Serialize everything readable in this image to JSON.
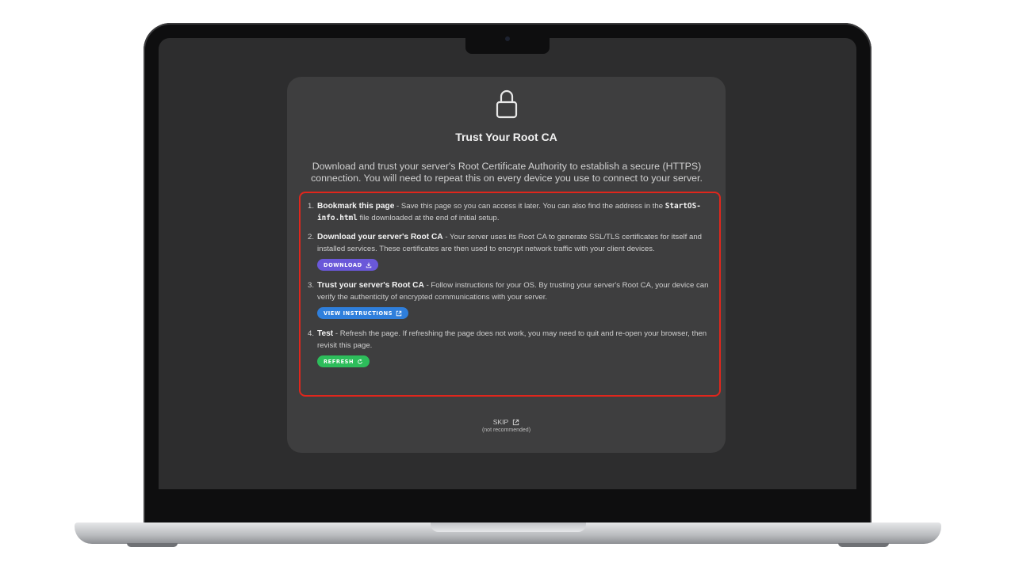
{
  "card": {
    "title": "Trust Your Root CA",
    "description": "Download and trust your server's Root Certificate Authority to establish a secure (HTTPS) connection. You will need to repeat this on every device you use to connect to your server."
  },
  "steps": [
    {
      "number": "1.",
      "title": "Bookmark this page",
      "text_before": " - Save this page so you can access it later. You can also find the address in the ",
      "code": "StartOS-info.html",
      "text_after": " file downloaded at the end of initial setup."
    },
    {
      "number": "2.",
      "title": "Download your server's Root CA",
      "text": " - Your server uses its Root CA to generate SSL/TLS certificates for itself and installed services. These certificates are then used to encrypt network traffic with your client devices.",
      "button": "DOWNLOAD",
      "button_icon": "download-icon"
    },
    {
      "number": "3.",
      "title": "Trust your server's Root CA",
      "text": " - Follow instructions for your OS. By trusting your server's Root CA, your device can verify the authenticity of encrypted communications with your server.",
      "button": "VIEW INSTRUCTIONS",
      "button_icon": "external-link-icon"
    },
    {
      "number": "4.",
      "title": "Test",
      "text": " - Refresh the page. If refreshing the page does not work, you may need to quit and re-open your browser, then revisit this page.",
      "button": "REFRESH",
      "button_icon": "refresh-icon"
    }
  ],
  "skip": {
    "label": "SKIP",
    "note": "(not recommended)"
  },
  "colors": {
    "download_button": "#6a58d9",
    "instructions_button": "#2f7fdc",
    "refresh_button": "#2dbd5b",
    "highlight_border": "#e0261c"
  }
}
